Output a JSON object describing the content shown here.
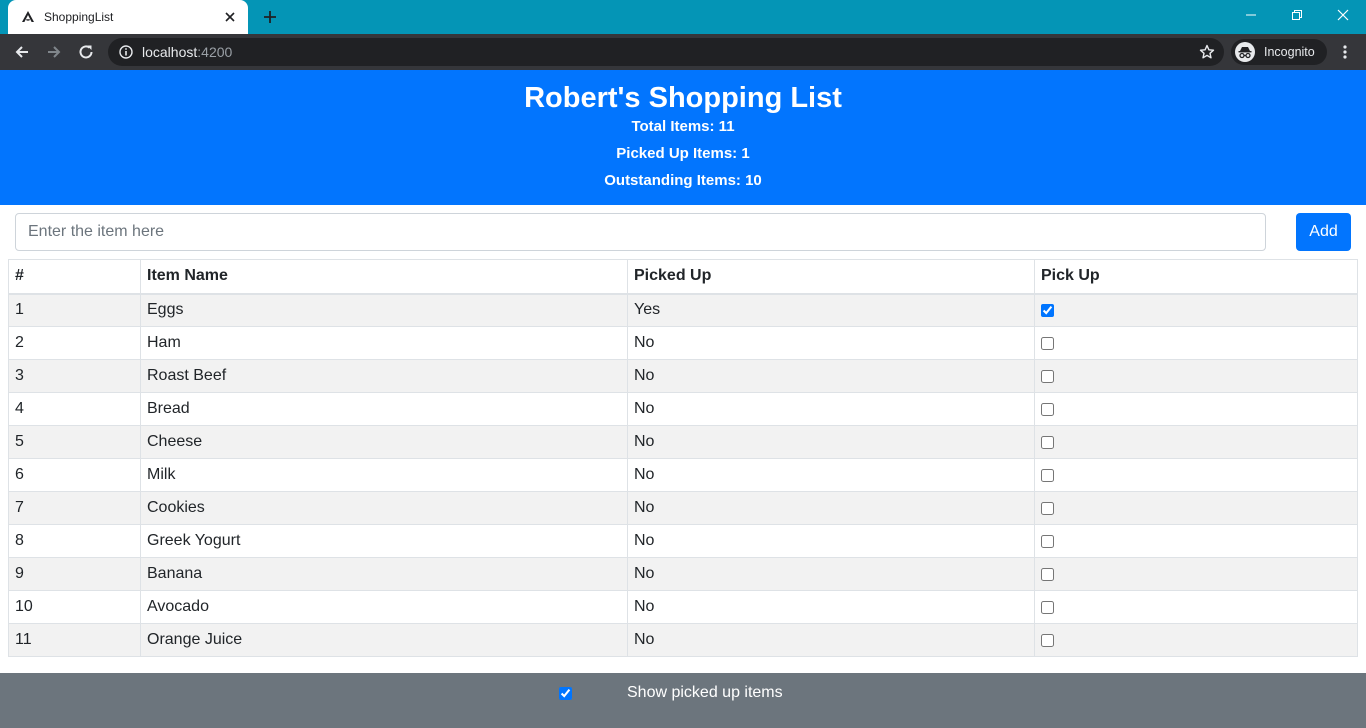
{
  "browser": {
    "tab_title": "ShoppingList",
    "url_host": "localhost",
    "url_port": ":4200",
    "profile_label": "Incognito"
  },
  "header": {
    "title": "Robert's Shopping List",
    "total_label": "Total Items: 11",
    "picked_label": "Picked Up Items: 1",
    "outstanding_label": "Outstanding Items: 10",
    "background_color": "#0275fe"
  },
  "form": {
    "placeholder": "Enter the item here",
    "add_label": "Add"
  },
  "table": {
    "headers": [
      "#",
      "Item Name",
      "Picked Up",
      "Pick Up"
    ],
    "rows": [
      {
        "num": "1",
        "name": "Eggs",
        "picked": "Yes",
        "checked": true
      },
      {
        "num": "2",
        "name": "Ham",
        "picked": "No",
        "checked": false
      },
      {
        "num": "3",
        "name": "Roast Beef",
        "picked": "No",
        "checked": false
      },
      {
        "num": "4",
        "name": "Bread",
        "picked": "No",
        "checked": false
      },
      {
        "num": "5",
        "name": "Cheese",
        "picked": "No",
        "checked": false
      },
      {
        "num": "6",
        "name": "Milk",
        "picked": "No",
        "checked": false
      },
      {
        "num": "7",
        "name": "Cookies",
        "picked": "No",
        "checked": false
      },
      {
        "num": "8",
        "name": "Greek Yogurt",
        "picked": "No",
        "checked": false
      },
      {
        "num": "9",
        "name": "Banana",
        "picked": "No",
        "checked": false
      },
      {
        "num": "10",
        "name": "Avocado",
        "picked": "No",
        "checked": false
      },
      {
        "num": "11",
        "name": "Orange Juice",
        "picked": "No",
        "checked": false
      }
    ]
  },
  "footer": {
    "show_picked_label": "Show picked up items",
    "show_picked_checked": true,
    "background_color": "#6c757d"
  }
}
